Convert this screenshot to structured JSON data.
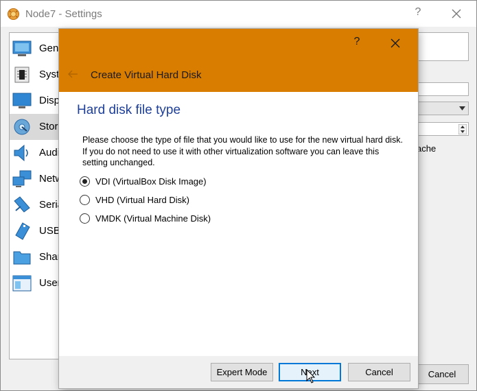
{
  "window": {
    "title": "Node7 - Settings",
    "help_glyph": "?",
    "cache_fragment": "ache",
    "cancel_label": "Cancel"
  },
  "sidebar": {
    "items": [
      {
        "label": "Gene",
        "icon": "general-icon"
      },
      {
        "label": "Syste",
        "icon": "system-icon"
      },
      {
        "label": "Disp",
        "icon": "display-icon"
      },
      {
        "label": "Stora",
        "icon": "storage-icon",
        "selected": true
      },
      {
        "label": "Audi",
        "icon": "audio-icon"
      },
      {
        "label": "Netw",
        "icon": "network-icon"
      },
      {
        "label": "Seria",
        "icon": "serial-icon"
      },
      {
        "label": "USB",
        "icon": "usb-icon"
      },
      {
        "label": "Shar",
        "icon": "shared-folders-icon"
      },
      {
        "label": "User",
        "icon": "user-interface-icon"
      }
    ]
  },
  "dialog": {
    "header_title": "Create Virtual Hard Disk",
    "help_glyph": "?",
    "page_title": "Hard disk file type",
    "description": "Please choose the type of file that you would like to use for the new virtual hard disk. If you do not need to use it with other virtualization software you can leave this setting unchanged.",
    "options": [
      {
        "label": "VDI (VirtualBox Disk Image)",
        "checked": true
      },
      {
        "label": "VHD (Virtual Hard Disk)",
        "checked": false
      },
      {
        "label": "VMDK (Virtual Machine Disk)",
        "checked": false
      }
    ],
    "buttons": {
      "expert": "Expert Mode",
      "next": "Next",
      "cancel": "Cancel"
    }
  },
  "colors": {
    "header_accent": "#d97d00",
    "page_title": "#1e3f99",
    "default_button_border": "#0078d7"
  }
}
